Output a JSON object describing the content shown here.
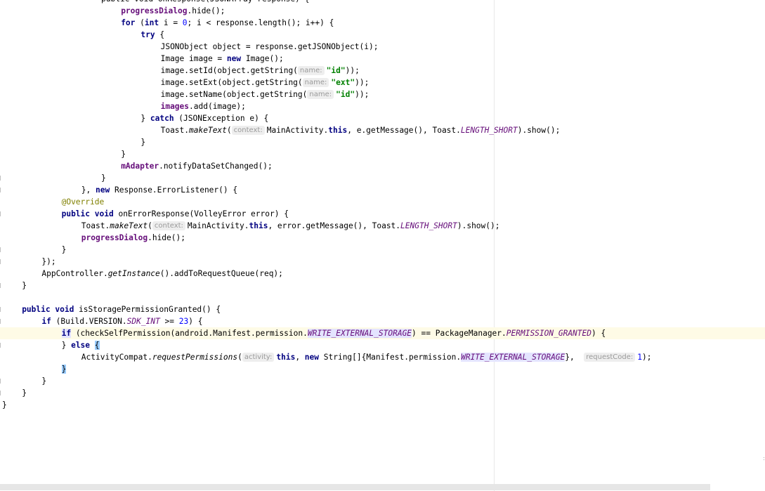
{
  "editor": {
    "language": "Java",
    "resize_dots": ":"
  },
  "lines": [
    {
      "indent": 5,
      "tokens": [
        {
          "t": "public void onResponse(JSONArray response) {",
          "c": "plain"
        }
      ]
    },
    {
      "indent": 6,
      "tokens": [
        {
          "t": "progressDialog",
          "c": "field"
        },
        {
          "t": ".hide();",
          "c": "plain"
        }
      ]
    },
    {
      "indent": 6,
      "tokens": [
        {
          "t": "for",
          "c": "kw"
        },
        {
          "t": " (",
          "c": "plain"
        },
        {
          "t": "int",
          "c": "kw"
        },
        {
          "t": " i = ",
          "c": "plain"
        },
        {
          "t": "0",
          "c": "num"
        },
        {
          "t": "; i < response.length(); i++) {",
          "c": "plain"
        }
      ]
    },
    {
      "indent": 7,
      "tokens": [
        {
          "t": "try",
          "c": "kw"
        },
        {
          "t": " {",
          "c": "plain"
        }
      ]
    },
    {
      "indent": 8,
      "tokens": [
        {
          "t": "JSONObject object = response.getJSONObject(i);",
          "c": "plain"
        }
      ]
    },
    {
      "indent": 8,
      "tokens": [
        {
          "t": "Image image = ",
          "c": "plain"
        },
        {
          "t": "new",
          "c": "kw"
        },
        {
          "t": " Image();",
          "c": "plain"
        }
      ]
    },
    {
      "indent": 8,
      "tokens": [
        {
          "t": "image.setId(object.getString(",
          "c": "plain"
        },
        {
          "t": "name:",
          "c": "hint"
        },
        {
          "t": "\"id\"",
          "c": "str"
        },
        {
          "t": "));",
          "c": "plain"
        }
      ]
    },
    {
      "indent": 8,
      "tokens": [
        {
          "t": "image.setExt(object.getString(",
          "c": "plain"
        },
        {
          "t": "name:",
          "c": "hint"
        },
        {
          "t": "\"ext\"",
          "c": "str"
        },
        {
          "t": "));",
          "c": "plain"
        }
      ]
    },
    {
      "indent": 8,
      "tokens": [
        {
          "t": "image.setName(object.getString(",
          "c": "plain"
        },
        {
          "t": "name:",
          "c": "hint"
        },
        {
          "t": "\"id\"",
          "c": "str"
        },
        {
          "t": "));",
          "c": "plain"
        }
      ]
    },
    {
      "indent": 8,
      "tokens": [
        {
          "t": "images",
          "c": "field"
        },
        {
          "t": ".add(image);",
          "c": "plain"
        }
      ]
    },
    {
      "indent": 7,
      "tokens": [
        {
          "t": "} ",
          "c": "plain"
        },
        {
          "t": "catch",
          "c": "kw"
        },
        {
          "t": " (JSONException e) {",
          "c": "plain"
        }
      ]
    },
    {
      "indent": 8,
      "tokens": [
        {
          "t": "Toast.",
          "c": "plain"
        },
        {
          "t": "makeText",
          "c": "static-method"
        },
        {
          "t": "(",
          "c": "plain"
        },
        {
          "t": "context:",
          "c": "hint"
        },
        {
          "t": "MainActivity.",
          "c": "plain"
        },
        {
          "t": "this",
          "c": "kw"
        },
        {
          "t": ", e.getMessage(), Toast.",
          "c": "plain"
        },
        {
          "t": "LENGTH_SHORT",
          "c": "static-field"
        },
        {
          "t": ").show();",
          "c": "plain"
        }
      ]
    },
    {
      "indent": 7,
      "tokens": [
        {
          "t": "}",
          "c": "plain"
        }
      ]
    },
    {
      "indent": 6,
      "tokens": [
        {
          "t": "}",
          "c": "plain"
        }
      ]
    },
    {
      "indent": 6,
      "tokens": [
        {
          "t": "mAdapter",
          "c": "field"
        },
        {
          "t": ".notifyDataSetChanged();",
          "c": "plain"
        }
      ]
    },
    {
      "indent": 5,
      "tokens": [
        {
          "t": "}",
          "c": "plain"
        }
      ],
      "gutter": true
    },
    {
      "indent": 4,
      "tokens": [
        {
          "t": "}, ",
          "c": "plain"
        },
        {
          "t": "new",
          "c": "kw"
        },
        {
          "t": " Response.ErrorListener() {",
          "c": "plain"
        }
      ],
      "gutter": true
    },
    {
      "indent": 3,
      "tokens": [
        {
          "t": "@Override",
          "c": "anno"
        }
      ]
    },
    {
      "indent": 3,
      "tokens": [
        {
          "t": "public",
          "c": "kw"
        },
        {
          "t": " ",
          "c": "plain"
        },
        {
          "t": "void",
          "c": "kw"
        },
        {
          "t": " onErrorResponse(VolleyError error) {",
          "c": "plain"
        }
      ],
      "gutter": true
    },
    {
      "indent": 4,
      "tokens": [
        {
          "t": "Toast.",
          "c": "plain"
        },
        {
          "t": "makeText",
          "c": "static-method"
        },
        {
          "t": "(",
          "c": "plain"
        },
        {
          "t": "context:",
          "c": "hint"
        },
        {
          "t": "MainActivity.",
          "c": "plain"
        },
        {
          "t": "this",
          "c": "kw"
        },
        {
          "t": ", error.getMessage(), Toast.",
          "c": "plain"
        },
        {
          "t": "LENGTH_SHORT",
          "c": "static-field"
        },
        {
          "t": ").show();",
          "c": "plain"
        }
      ]
    },
    {
      "indent": 4,
      "tokens": [
        {
          "t": "progressDialog",
          "c": "field"
        },
        {
          "t": ".hide();",
          "c": "plain"
        }
      ]
    },
    {
      "indent": 3,
      "tokens": [
        {
          "t": "}",
          "c": "plain"
        }
      ],
      "gutter": true
    },
    {
      "indent": 2,
      "tokens": [
        {
          "t": "});",
          "c": "plain"
        }
      ],
      "gutter": true
    },
    {
      "indent": 2,
      "tokens": [
        {
          "t": "AppController.",
          "c": "plain"
        },
        {
          "t": "getInstance",
          "c": "static-method"
        },
        {
          "t": "().addToRequestQueue(req);",
          "c": "plain"
        }
      ]
    },
    {
      "indent": 1,
      "tokens": [
        {
          "t": "}",
          "c": "plain"
        }
      ],
      "gutter": true
    },
    {
      "indent": 0,
      "tokens": []
    },
    {
      "indent": 1,
      "tokens": [
        {
          "t": "public",
          "c": "kw"
        },
        {
          "t": " ",
          "c": "plain"
        },
        {
          "t": "void",
          "c": "kw"
        },
        {
          "t": " isStoragePermissionGranted() {",
          "c": "plain"
        }
      ],
      "gutter": true
    },
    {
      "indent": 2,
      "tokens": [
        {
          "t": "if",
          "c": "kw"
        },
        {
          "t": " (Build.VERSION.",
          "c": "plain"
        },
        {
          "t": "SDK_INT",
          "c": "static-field"
        },
        {
          "t": " >= ",
          "c": "plain"
        },
        {
          "t": "23",
          "c": "num"
        },
        {
          "t": ") {",
          "c": "plain"
        }
      ],
      "gutter": true
    },
    {
      "indent": 3,
      "current": true,
      "tokens": [
        {
          "t": "if",
          "c": "kw highlight"
        },
        {
          "t": " (checkSelfPermission(android.Manifest.permission.",
          "c": "plain"
        },
        {
          "t": "WRITE_EXTERNAL_STORAGE",
          "c": "static-field highlight"
        },
        {
          "t": ") == PackageManager.",
          "c": "plain"
        },
        {
          "t": "PERMISSION_GRANTED",
          "c": "static-field"
        },
        {
          "t": ") {",
          "c": "plain"
        }
      ]
    },
    {
      "indent": 3,
      "tokens": [
        {
          "t": "} ",
          "c": "plain"
        },
        {
          "t": "else",
          "c": "kw"
        },
        {
          "t": " ",
          "c": "plain"
        },
        {
          "t": "{",
          "c": "brace-match"
        }
      ],
      "gutter": true
    },
    {
      "indent": 4,
      "tokens": [
        {
          "t": "ActivityCompat.",
          "c": "plain"
        },
        {
          "t": "requestPermissions",
          "c": "static-method"
        },
        {
          "t": "(",
          "c": "plain"
        },
        {
          "t": "activity:",
          "c": "hint"
        },
        {
          "t": "this",
          "c": "kw"
        },
        {
          "t": ", ",
          "c": "plain"
        },
        {
          "t": "new",
          "c": "kw"
        },
        {
          "t": " String[]{Manifest.permission.",
          "c": "plain"
        },
        {
          "t": "WRITE_EXTERNAL_STORAGE",
          "c": "static-field highlight"
        },
        {
          "t": "},  ",
          "c": "plain"
        },
        {
          "t": "requestCode:",
          "c": "hint"
        },
        {
          "t": "1",
          "c": "num"
        },
        {
          "t": ");",
          "c": "plain"
        }
      ]
    },
    {
      "indent": 3,
      "tokens": [
        {
          "t": "}",
          "c": "brace-match"
        }
      ]
    },
    {
      "indent": 2,
      "tokens": [
        {
          "t": "}",
          "c": "plain"
        }
      ],
      "gutter": true
    },
    {
      "indent": 1,
      "tokens": [
        {
          "t": "}",
          "c": "plain"
        }
      ],
      "gutter": true
    },
    {
      "indent": 0,
      "tokens": [
        {
          "t": "}",
          "c": "plain"
        }
      ]
    }
  ]
}
